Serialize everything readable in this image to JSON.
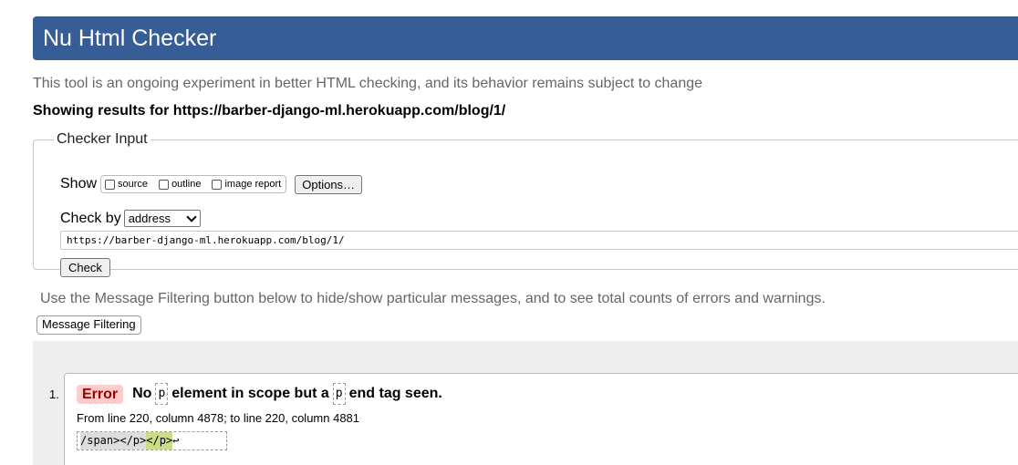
{
  "header": {
    "title": "Nu Html Checker"
  },
  "intro_text": "This tool is an ongoing experiment in better HTML checking, and its behavior remains subject to change",
  "showing_results": "Showing results for https://barber-django-ml.herokuapp.com/blog/1/",
  "checker_input": {
    "legend": "Checker Input",
    "show_label": "Show",
    "show_options": [
      "source",
      "outline",
      "image report"
    ],
    "options_button": "Options…",
    "check_by_label": "Check by",
    "check_by_selected": "address",
    "url_value": "https://barber-django-ml.herokuapp.com/blog/1/",
    "check_button": "Check"
  },
  "filter": {
    "note": "Use the Message Filtering button below to hide/show particular messages, and to see total counts of errors and warnings.",
    "button": "Message Filtering"
  },
  "messages": [
    {
      "number": "1.",
      "type": "Error",
      "text_parts": [
        "No",
        "p",
        "element in scope but a",
        "p",
        "end tag seen."
      ],
      "location": "From line 220, column 4878; to line 220, column 4881",
      "extract_before": "/span></p>",
      "extract_highlight": "</p>",
      "extract_after": "↩"
    }
  ],
  "colors": {
    "title_bar": "#365d95",
    "error_badge_bg": "#ffcccc",
    "error_badge_text": "#990000",
    "results_bg": "#eeeeee"
  }
}
